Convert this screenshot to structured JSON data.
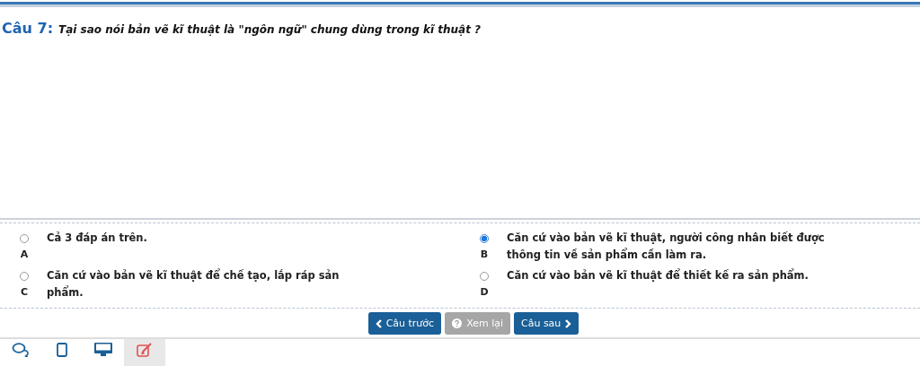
{
  "question": {
    "number": "Câu 7:",
    "text": "Tại sao nói bản vẽ kĩ thuật là \"ngôn ngữ\" chung dùng trong kĩ thuật ?"
  },
  "options": [
    {
      "letter": "A",
      "text": "Cả 3 đáp án trên.",
      "selected": false
    },
    {
      "letter": "B",
      "text": "Căn cứ vào bản vẽ kĩ thuật, người công nhân biết được thông tin về sản phẩm cần làm ra.",
      "selected": true
    },
    {
      "letter": "C",
      "text": "Căn cứ vào bản vẽ kĩ thuật để chế tạo, lắp ráp sản phẩm.",
      "selected": false
    },
    {
      "letter": "D",
      "text": "Căn cứ vào bản vẽ kĩ thuật để thiết kế ra sản phẩm.",
      "selected": false
    }
  ],
  "nav_buttons": [
    {
      "kind": "prev",
      "label": "Câu trước",
      "disabled": false
    },
    {
      "kind": "review",
      "label": "Xem lại",
      "disabled": true
    },
    {
      "kind": "next",
      "label": "Câu sau",
      "disabled": false
    }
  ],
  "bottom_tabs": [
    {
      "kind": "chat",
      "selected": false
    },
    {
      "kind": "tablet",
      "selected": false
    },
    {
      "kind": "monitor",
      "selected": false
    },
    {
      "kind": "edit",
      "selected": true
    }
  ]
}
